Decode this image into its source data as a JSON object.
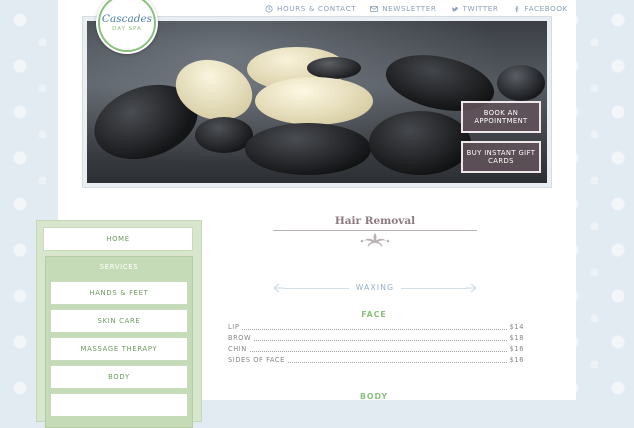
{
  "brand": {
    "name": "Cascades",
    "sub": "DAY SPA"
  },
  "topnav": [
    {
      "label": "HOURS & CONTACT",
      "icon": "clock-icon"
    },
    {
      "label": "NEWSLETTER",
      "icon": "envelope-icon"
    },
    {
      "label": "TWITTER",
      "icon": "twitter-icon"
    },
    {
      "label": "FACEBOOK",
      "icon": "facebook-icon"
    }
  ],
  "hero": {
    "book_label": "BOOK AN APPOINTMENT",
    "gift_label": "BUY INSTANT GIFT CARDS"
  },
  "sidebar": {
    "home": "HOME",
    "services": "SERVICES",
    "items": [
      "HANDS & FEET",
      "SKIN CARE",
      "MASSAGE THERAPY",
      "BODY"
    ]
  },
  "content": {
    "title": "Hair Removal",
    "subsection": "WAXING",
    "face_label": "FACE",
    "face_prices": [
      {
        "name": "LIP",
        "price": "$14"
      },
      {
        "name": "BROW",
        "price": "$18"
      },
      {
        "name": "CHIN",
        "price": "$16"
      },
      {
        "name": "SIDES OF FACE",
        "price": "$16"
      }
    ],
    "body_label": "BODY"
  },
  "colors": {
    "accent_green": "#8cbf7e",
    "accent_blue": "#8aa1bb",
    "button_bg": "#61525a",
    "title_mauve": "#8d7982"
  }
}
